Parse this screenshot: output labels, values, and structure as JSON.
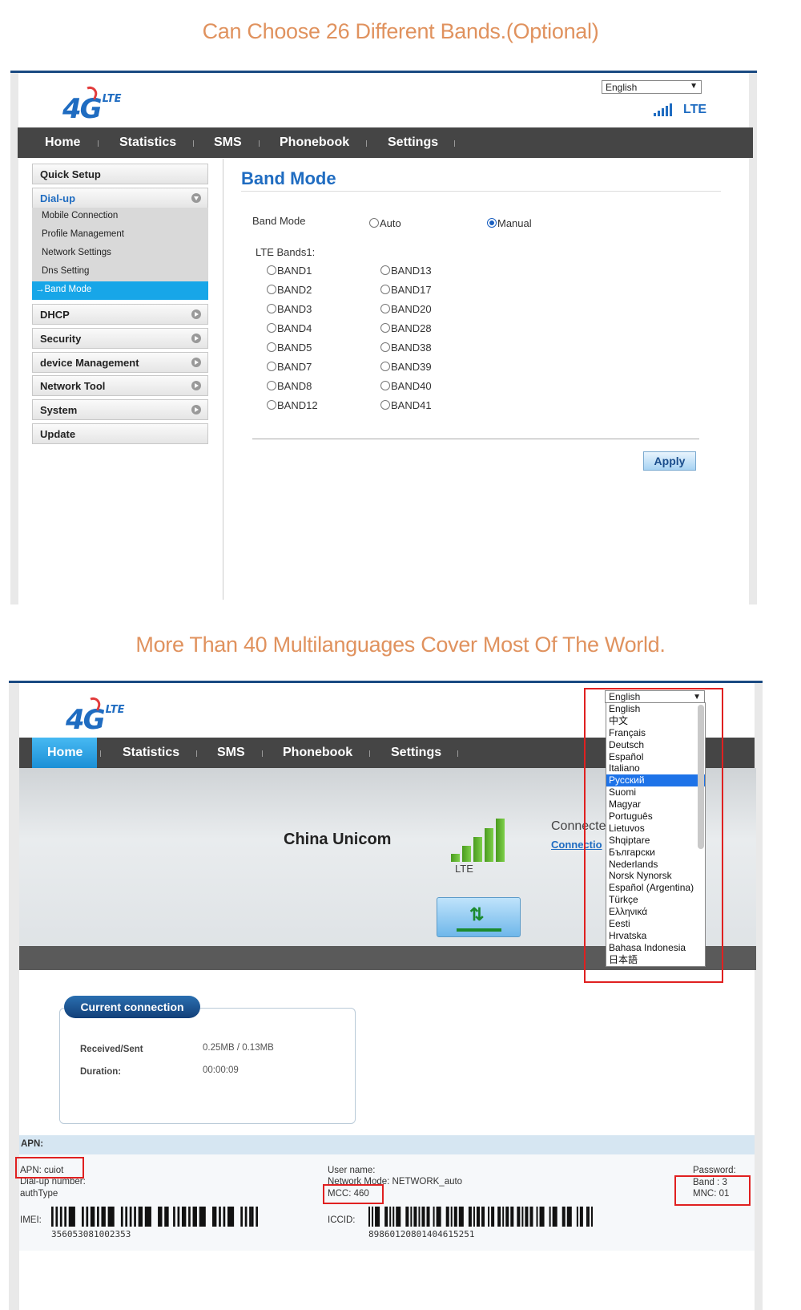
{
  "caption_top": "Can Choose 26 Different Bands.(Optional)",
  "caption_bottom": "More Than 40 Multilanguages Cover Most Of The World.",
  "logo": {
    "main": "4G",
    "sub": "LTE"
  },
  "language": {
    "selected": "English"
  },
  "network_type": "LTE",
  "nav": [
    "Home",
    "Statistics",
    "SMS",
    "Phonebook",
    "Settings"
  ],
  "sidebar": {
    "quick_setup": "Quick Setup",
    "dialup": "Dial-up",
    "sub_items": [
      "Mobile Connection",
      "Profile Management",
      "Network Settings",
      "Dns Setting",
      "Band Mode"
    ],
    "active_sub": "→Band Mode",
    "dhcp": "DHCP",
    "security": "Security",
    "device_management": "device Management",
    "network_tool": "Network Tool",
    "system": "System",
    "update": "Update"
  },
  "band_mode": {
    "title": "Band Mode",
    "label": "Band Mode",
    "auto_label": "Auto",
    "manual_label": "Manual",
    "selected": "Manual",
    "lte_bands_label": "LTE Bands1:",
    "bands_col1": [
      "BAND1",
      "BAND2",
      "BAND3",
      "BAND4",
      "BAND5",
      "BAND7",
      "BAND8",
      "BAND12"
    ],
    "bands_col2": [
      "BAND13",
      "BAND17",
      "BAND20",
      "BAND28",
      "BAND38",
      "BAND39",
      "BAND40",
      "BAND41"
    ],
    "apply": "Apply"
  },
  "home": {
    "operator": "China Unicom",
    "signal_type": "LTE",
    "connected_label": "Connecte",
    "connection_link": "Connectio",
    "current_connection": "Current connection",
    "received_sent_label": "Received/Sent",
    "received_sent_value": "0.25MB /  0.13MB",
    "duration_label": "Duration:",
    "duration_value": "00:00:09"
  },
  "language_options": [
    "English",
    "中文",
    "Français",
    "Deutsch",
    "Español",
    "Italiano",
    "Русский",
    "Suomi",
    "Magyar",
    "Português",
    "Lietuvos",
    "Shqiptare",
    "Български",
    "Nederlands",
    "Norsk Nynorsk",
    "Español (Argentina)",
    "Türkçe",
    "Ελληνικά",
    "Eesti",
    "Hrvatska",
    "Bahasa Indonesia",
    "日本語"
  ],
  "highlighted_language": "Русский",
  "apn_info": {
    "header": "APN:",
    "apn": "APN: cuiot",
    "dialup_number": "Dial-up number:",
    "auth_type": "authType",
    "user_name": "User name:",
    "network_mode": "Network Mode: NETWORK_auto",
    "mcc": "MCC:  460",
    "password": "Password:",
    "band": "Band :   3",
    "mnc": "MNC:  01",
    "imei_label": "IMEI:",
    "imei_value": "356053081002353",
    "iccid_label": "ICCID:",
    "iccid_value": "89860120801404615251"
  },
  "colors": {
    "caption": "#e0925e",
    "brand_blue": "#1f6cc1",
    "nav_bg": "#454545",
    "active_blue": "#17a6e8",
    "highlight_red": "#e02020"
  }
}
